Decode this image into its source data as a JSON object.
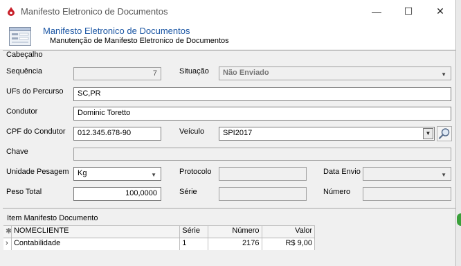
{
  "window": {
    "title": "Manifesto Eletronico de Documentos",
    "minimize": "—",
    "maximize": "☐",
    "close": "✕"
  },
  "header": {
    "title": "Manifesto Eletronico de Documentos",
    "subtitle": "Manutenção de Manifesto Eletronico de Documentos"
  },
  "cabecalho": {
    "section_label": "Cabeçalho",
    "sequencia_label": "Sequência",
    "sequencia_value": "7",
    "situacao_label": "Situação",
    "situacao_value": "Não Enviado",
    "ufs_label": "UFs do Percurso",
    "ufs_value": "SC,PR",
    "condutor_label": "Condutor",
    "condutor_value": "Dominic Toretto",
    "cpf_label": "CPF do Condutor",
    "cpf_value": "012.345.678-90",
    "veiculo_label": "Veículo",
    "veiculo_value": "SPI2017",
    "chave_label": "Chave",
    "chave_value": "",
    "unidade_label": "Unidade Pesagem",
    "unidade_value": "Kg",
    "protocolo_label": "Protocolo",
    "protocolo_value": "",
    "data_envio_label": "Data Envio",
    "data_envio_value": "",
    "peso_label": "Peso Total",
    "peso_value": "100,0000",
    "serie_label": "Série",
    "serie_value": "",
    "numero_label": "Número",
    "numero_value": ""
  },
  "items": {
    "section_label": "Item Manifesto Documento",
    "columns": [
      "NOMECLIENTE",
      "Série",
      "Número",
      "Valor"
    ],
    "rows": [
      {
        "nomecliente": "Contabilidade",
        "serie": "1",
        "numero": "2176",
        "valor": "R$ 9,00"
      }
    ]
  },
  "icons": {
    "app": "droplet-icon",
    "header": "form-icon",
    "search": "magnifier-icon",
    "dropdown": "chevron-down-icon"
  }
}
